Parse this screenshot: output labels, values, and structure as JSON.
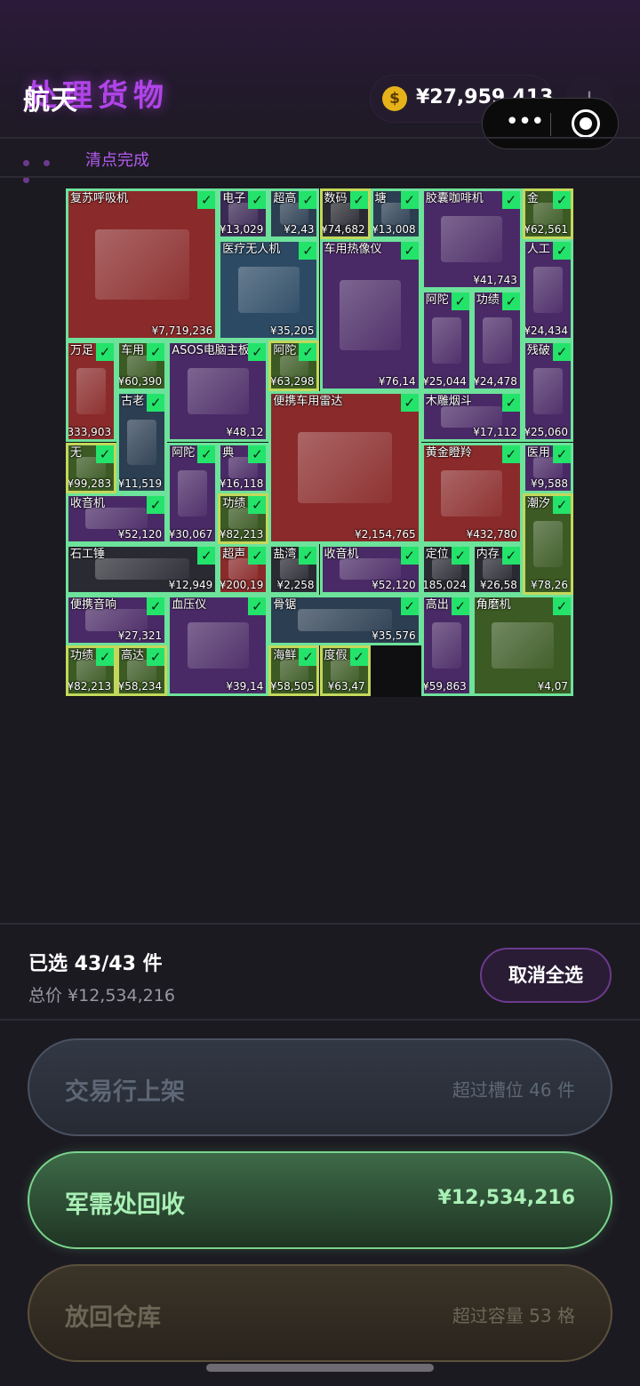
{
  "header": {
    "title_back": "处理货物",
    "title_front": "航天",
    "currency_icon": "$",
    "balance": "¥27,959,413",
    "add_label": "+",
    "status_text": "清点完成"
  },
  "grid_items": [
    {
      "label": "复苏呼吸机",
      "price": "¥7,719,236",
      "bg": "#8a2a2a",
      "gold": false,
      "h": 1
    },
    {
      "label": "电子",
      "price": "¥13,029",
      "bg": "#3c2a55",
      "gold": false,
      "h": 1
    },
    {
      "label": "超高",
      "price": "¥2,43",
      "bg": "#2c3e52",
      "gold": false,
      "h": 1
    },
    {
      "label": "数码",
      "price": "¥74,682",
      "bg": "#2a2a33",
      "gold": true,
      "h": 1
    },
    {
      "label": "塘",
      "price": "¥13,008",
      "bg": "#2c3e52",
      "gold": false,
      "h": 1
    },
    {
      "label": "胶囊咖啡机",
      "price": "¥41,743",
      "bg": "#4a2a66",
      "gold": false,
      "h": 1
    },
    {
      "label": "金",
      "price": "¥62,561",
      "bg": "#3c5a24",
      "gold": true,
      "h": 1
    },
    {
      "label": "医疗无人机",
      "price": "¥35,205",
      "bg": "#2c4a64",
      "gold": false,
      "h": 1
    },
    {
      "label": "车用热像仪",
      "price": "¥76,14",
      "bg": "#4a2a66",
      "gold": false,
      "h": 1
    },
    {
      "label": "人工",
      "price": "¥24,434",
      "bg": "#4a2a66",
      "gold": false,
      "h": 1
    },
    {
      "label": "阿陀",
      "price": "¥25,044",
      "bg": "#4a2a66",
      "gold": false,
      "h": 1
    },
    {
      "label": "功绩",
      "price": "¥24,478",
      "bg": "#4a2a66",
      "gold": false,
      "h": 1
    },
    {
      "label": "万足",
      "price": "¥333,903",
      "bg": "#8a2a2a",
      "gold": false,
      "h": 1
    },
    {
      "label": "车用",
      "price": "¥60,390",
      "bg": "#3c5a24",
      "gold": false,
      "h": 1
    },
    {
      "label": "ASOS电脑主板",
      "price": "¥48,12",
      "bg": "#4a2a66",
      "gold": false,
      "h": 1
    },
    {
      "label": "阿陀",
      "price": "¥63,298",
      "bg": "#3c5a24",
      "gold": true,
      "h": 1
    },
    {
      "label": "残破",
      "price": "¥25,060",
      "bg": "#4a2a66",
      "gold": false,
      "h": 1
    },
    {
      "label": "古老",
      "price": "¥11,519",
      "bg": "#2c3e52",
      "gold": false,
      "h": 1
    },
    {
      "label": "便携车用雷达",
      "price": "¥2,154,765",
      "bg": "#8a2a2a",
      "gold": false,
      "h": 1
    },
    {
      "label": "木雕烟斗",
      "price": "¥17,112",
      "bg": "#4a2a66",
      "gold": false,
      "h": 1
    },
    {
      "label": "无",
      "price": "¥99,283",
      "bg": "#3c5a24",
      "gold": true,
      "h": 1
    },
    {
      "label": "阿陀",
      "price": "¥30,067",
      "bg": "#4a2a66",
      "gold": false,
      "h": 1
    },
    {
      "label": "典",
      "price": "¥16,118",
      "bg": "#4a2a66",
      "gold": false,
      "h": 1
    },
    {
      "label": "黄金瞪羚",
      "price": "¥432,780",
      "bg": "#8a2a2a",
      "gold": false,
      "h": 1
    },
    {
      "label": "医用",
      "price": "¥9,588",
      "bg": "#4a2a66",
      "gold": false,
      "h": 1
    },
    {
      "label": "收音机",
      "price": "¥52,120",
      "bg": "#4a2a66",
      "gold": false,
      "h": 1
    },
    {
      "label": "功绩",
      "price": "¥82,213",
      "bg": "#3c5a24",
      "gold": true,
      "h": 1
    },
    {
      "label": "潮汐",
      "price": "¥78,26",
      "bg": "#3c5a24",
      "gold": true,
      "h": 1
    },
    {
      "label": "石工锤",
      "price": "¥12,949",
      "bg": "#2a2a33",
      "gold": false,
      "h": 1
    },
    {
      "label": "超声",
      "price": "¥200,19",
      "bg": "#8a2a2a",
      "gold": false,
      "h": 1
    },
    {
      "label": "盐湾",
      "price": "¥2,258",
      "bg": "#2a2a33",
      "gold": false,
      "h": 1
    },
    {
      "label": "收音机",
      "price": "¥52,120",
      "bg": "#4a2a66",
      "gold": false,
      "h": 1
    },
    {
      "label": "定位",
      "price": "¥185,024",
      "bg": "#2a2a33",
      "gold": false,
      "h": 1
    },
    {
      "label": "内存",
      "price": "¥26,58",
      "bg": "#2a2a33",
      "gold": false,
      "h": 1
    },
    {
      "label": "便携音响",
      "price": "¥27,321",
      "bg": "#4a2a66",
      "gold": false,
      "h": 1
    },
    {
      "label": "血压仪",
      "price": "¥39,14",
      "bg": "#4a2a66",
      "gold": false,
      "h": 1
    },
    {
      "label": "骨锯",
      "price": "¥35,576",
      "bg": "#2c3e52",
      "gold": false,
      "h": 1
    },
    {
      "label": "高出",
      "price": "¥59,863",
      "bg": "#4a2a66",
      "gold": false,
      "h": 1
    },
    {
      "label": "角磨机",
      "price": "¥4,07",
      "bg": "#3c5a24",
      "gold": false,
      "h": 1
    },
    {
      "label": "功绩",
      "price": "¥82,213",
      "bg": "#3c5a24",
      "gold": true,
      "h": 1
    },
    {
      "label": "高达",
      "price": "¥58,234",
      "bg": "#3c5a24",
      "gold": true,
      "h": 1
    },
    {
      "label": "海鲜",
      "price": "¥58,505",
      "bg": "#3c5a24",
      "gold": true,
      "h": 1
    },
    {
      "label": "度假",
      "price": "¥63,47",
      "bg": "#3c5a24",
      "gold": true,
      "h": 1
    }
  ],
  "summary": {
    "selected": "已选 43/43 件",
    "total": "总价 ¥12,534,216",
    "cancel_all": "取消全选"
  },
  "actions": {
    "market_label": "交易行上架",
    "market_note": "超过槽位 46 件",
    "recycle_label": "军需处回收",
    "recycle_value": "¥12,534,216",
    "warehouse_label": "放回仓库",
    "warehouse_note": "超过容量 53 格"
  },
  "colors": {
    "accent": "#b044e8",
    "check": "#23e36b",
    "recycle": "#79d38d"
  }
}
